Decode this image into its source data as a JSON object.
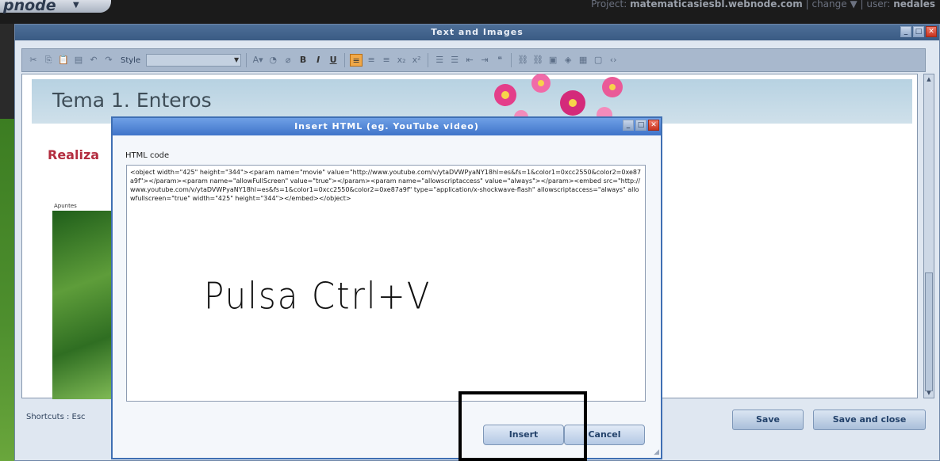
{
  "topbar": {
    "logo": "pnode",
    "logo_caret": "▼",
    "project_label": "Project:",
    "project_name": "matematicasiesbl.webnode.com",
    "separator1": "|",
    "change": "change ▼",
    "separator2": "|",
    "user_label": "user:",
    "user_name": "nedales"
  },
  "editor": {
    "title": "Text and Images",
    "toolbar": {
      "style_label": "Style",
      "style_value": "",
      "icons": [
        "cut-icon",
        "copy-icon",
        "paste-icon",
        "paste-word-icon",
        "undo-icon",
        "redo-icon"
      ],
      "format_icons": [
        {
          "name": "font-color-icon",
          "glyph": "A▾"
        },
        {
          "name": "bg-color-icon",
          "glyph": "◔▾"
        },
        {
          "name": "eraser-icon",
          "glyph": "⌀"
        },
        {
          "name": "bold-icon",
          "glyph": "B"
        },
        {
          "name": "italic-icon",
          "glyph": "I"
        },
        {
          "name": "underline-icon",
          "glyph": "U"
        },
        {
          "name": "align-left-icon",
          "glyph": "≡"
        },
        {
          "name": "align-center-icon",
          "glyph": "≡"
        },
        {
          "name": "align-right-icon",
          "glyph": "≡"
        },
        {
          "name": "subscript-icon",
          "glyph": "x₂"
        },
        {
          "name": "superscript-icon",
          "glyph": "x²"
        },
        {
          "name": "ordered-list-icon",
          "glyph": "☰"
        },
        {
          "name": "unordered-list-icon",
          "glyph": "☰"
        },
        {
          "name": "outdent-icon",
          "glyph": "⇤"
        },
        {
          "name": "indent-icon",
          "glyph": "⇥"
        },
        {
          "name": "quote-icon",
          "glyph": "““"
        },
        {
          "name": "link-icon",
          "glyph": "⛓"
        },
        {
          "name": "unlink-icon",
          "glyph": "⛓"
        },
        {
          "name": "image-icon",
          "glyph": "▣"
        },
        {
          "name": "flash-icon",
          "glyph": "◈"
        },
        {
          "name": "table-icon",
          "glyph": "▦"
        },
        {
          "name": "frame-icon",
          "glyph": "▢"
        },
        {
          "name": "source-icon",
          "glyph": "‹›"
        }
      ]
    },
    "heading": "Tema 1. Enteros",
    "sub_text": "Realiza",
    "thumb_caption": "Apuntes",
    "shortcuts": "Shortcuts : Esc",
    "save_label": "Save",
    "save_close_label": "Save and close"
  },
  "modal": {
    "title": "Insert HTML (eg. YouTube video)",
    "field_label": "HTML code",
    "code": "<object width=\"425\" height=\"344\"><param name=\"movie\" value=\"http://www.youtube.com/v/ytaDVWPyaNY18hl=es&fs=1&color1=0xcc2550&color2=0xe87a9f\"></param><param name=\"allowFullScreen\" value=\"true\"></param><param name=\"allowscriptaccess\" value=\"always\"></param><embed src=\"http://www.youtube.com/v/ytaDVWPyaNY18hl=es&fs=1&color1=0xcc2550&color2=0xe87a9f\" type=\"application/x-shockwave-flash\" allowscriptaccess=\"always\" allowfullscreen=\"true\" width=\"425\" height=\"344\"></embed></object>",
    "handwriting": "Pulsa Ctrl+V",
    "insert_label": "Insert",
    "cancel_label": "Cancel"
  },
  "colors": {
    "accent": "#3f74c9",
    "heading_band": "#b7d2e2",
    "red_text": "#b32d3f",
    "highlight": "#000000"
  }
}
